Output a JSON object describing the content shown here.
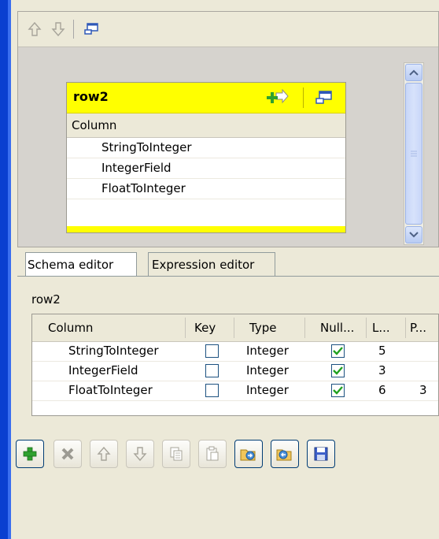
{
  "colors": {
    "accent_border": "#0a3fd0",
    "row_header_bg": "#ffff00",
    "check_green": "#21a121",
    "panel_bg": "#ece9d8"
  },
  "top_toolbar": {
    "buttons": [
      {
        "icon": "move-up-icon",
        "enabled": false
      },
      {
        "icon": "move-down-icon",
        "enabled": false
      },
      {
        "icon": "minimize-window-icon",
        "enabled": true
      }
    ]
  },
  "row_box": {
    "title": "row2",
    "column_header": "Column",
    "items": [
      "StringToInteger",
      "IntegerField",
      "FloatToInteger",
      ""
    ],
    "icons": [
      "add-input-icon",
      "minimize-window-icon"
    ]
  },
  "tabs": [
    {
      "label": "Schema editor",
      "active": true
    },
    {
      "label": "Expression editor",
      "active": false
    }
  ],
  "editor": {
    "schema_name": "row2",
    "table": {
      "headers": [
        "Column",
        "Key",
        "Type",
        "Null...",
        "L...",
        "P..."
      ],
      "rows": [
        {
          "column": "StringToInteger",
          "key": false,
          "type": "Integer",
          "nullable": true,
          "length": "5",
          "precision": ""
        },
        {
          "column": "IntegerField",
          "key": false,
          "type": "Integer",
          "nullable": true,
          "length": "3",
          "precision": ""
        },
        {
          "column": "FloatToInteger",
          "key": false,
          "type": "Integer",
          "nullable": true,
          "length": "6",
          "precision": "3"
        }
      ]
    },
    "toolbar": [
      {
        "icon": "add-icon",
        "enabled": true
      },
      {
        "icon": "delete-icon",
        "enabled": false
      },
      {
        "icon": "move-up-icon",
        "enabled": false
      },
      {
        "icon": "move-down-icon",
        "enabled": false
      },
      {
        "icon": "copy-icon",
        "enabled": false
      },
      {
        "icon": "paste-icon",
        "enabled": false
      },
      {
        "icon": "import-icon",
        "enabled": true
      },
      {
        "icon": "export-icon",
        "enabled": true
      },
      {
        "icon": "save-icon",
        "enabled": true
      }
    ]
  }
}
